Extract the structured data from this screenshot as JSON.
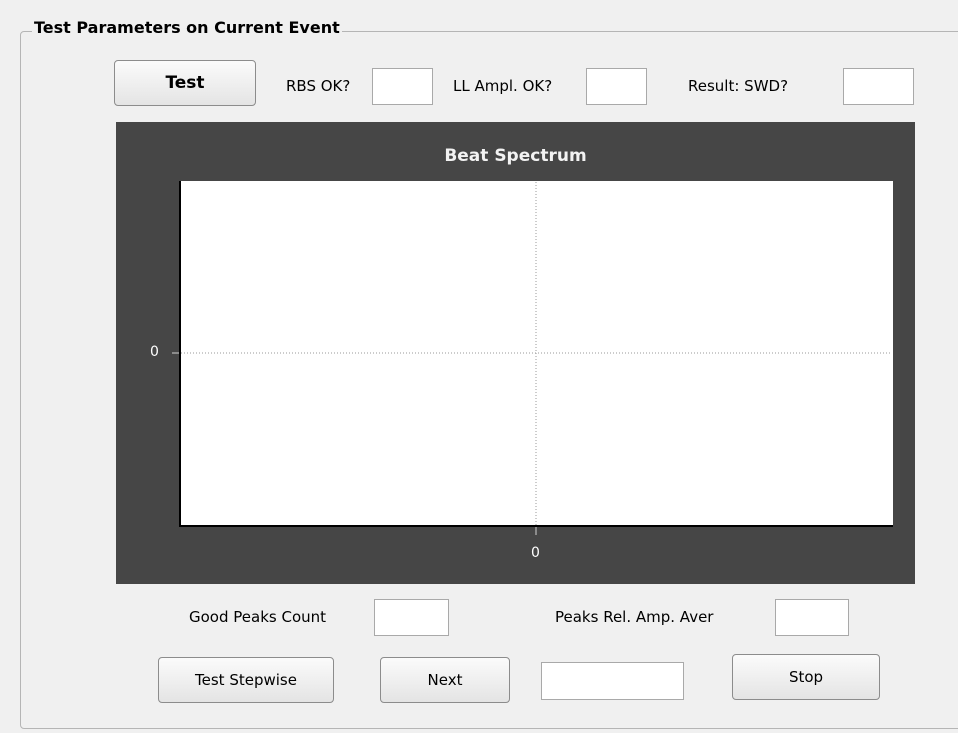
{
  "group": {
    "title": "Test Parameters on Current Event"
  },
  "toolbar": {
    "test_label": "Test",
    "rbs_label": "RBS OK?",
    "rbs_value": "",
    "ll_label": "LL Ampl. OK?",
    "ll_value": "",
    "result_label": "Result: SWD?",
    "result_value": ""
  },
  "chart_data": {
    "type": "line",
    "title": "Beat Spectrum",
    "xlabel": "",
    "ylabel": "",
    "x_ticks": [
      "0"
    ],
    "y_ticks": [
      "0"
    ],
    "series": [],
    "grid": true
  },
  "stats": {
    "good_peaks_label": "Good Peaks Count",
    "good_peaks_value": "",
    "peaks_rel_label": "Peaks Rel. Amp. Aver",
    "peaks_rel_value": ""
  },
  "controls": {
    "stepwise_label": "Test Stepwise",
    "next_label": "Next",
    "step_value": "",
    "stop_label": "Stop"
  },
  "colors": {
    "panel": "#464646",
    "plot_bg": "#ffffff",
    "grid": "#9a9a9a"
  }
}
